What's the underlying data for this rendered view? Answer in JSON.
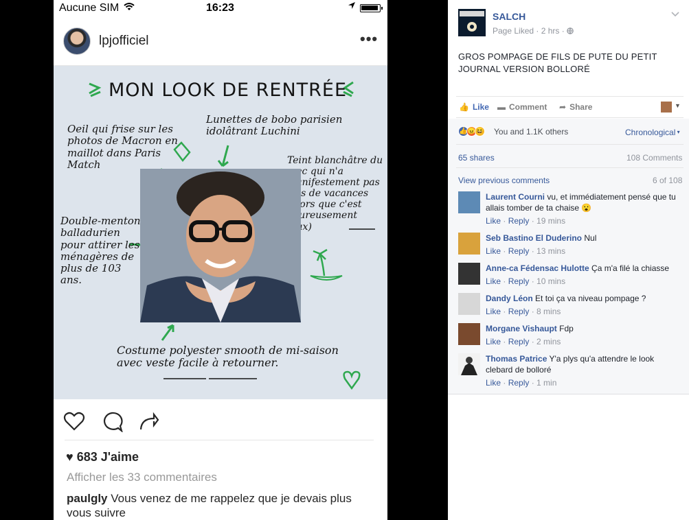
{
  "instagram": {
    "status": {
      "carrier": "Aucune SIM",
      "time": "16:23"
    },
    "username": "lpjofficiel",
    "image_text": {
      "title": "MON LOOK DE RENTRÉE",
      "note1": "Oeil qui frise sur les photos de Macron en maillot dans Paris Match",
      "note2": "Lunettes de bobo parisien idolâtrant Luchini",
      "note3": "Teint blanchâtre du mec qui n'a manifestement pas pris de vacances (alors que c'est heureusement faux)",
      "note4": "Double-menton balladurien pour attirer les ménagères de plus de 103 ans.",
      "note5": "Costume polyester smooth de mi-saison avec veste facile à retourner."
    },
    "likes": "683 J'aime",
    "view_all": "Afficher les 33 commentaires",
    "comment": {
      "author": "paulgly",
      "text": "Vous venez de me rappelez que je devais plus vous suivre"
    }
  },
  "facebook": {
    "page_name": "SALCH",
    "meta": "Page Liked · 2 hrs · ",
    "post_text": "GROS POMPAGE DE FILS DE PUTE DU PETIT JOURNAL VERSION BOLLORÉ",
    "actions": {
      "like": "Like",
      "comment": "Comment",
      "share": "Share"
    },
    "reactions_text": "You and 1.1K others",
    "sort": "Chronological",
    "shares": "65 shares",
    "comments_count": "108 Comments",
    "view_previous": "View previous comments",
    "page_of": "6 of 108",
    "comments": [
      {
        "author": "Laurent Courni",
        "text": "vu, et immédiatement pensé que tu allais tomber de ta chaise 😮",
        "like": "Like",
        "reply": "Reply",
        "time": "19 mins",
        "color": "#5d8ab5"
      },
      {
        "author": "Seb Bastino El Duderino",
        "text": "Nul",
        "like": "Like",
        "reply": "Reply",
        "time": "13 mins",
        "color": "#d9a23c"
      },
      {
        "author": "Anne-ca Fédensac Hulotte",
        "text": "Ça m'a filé la chiasse",
        "like": "Like",
        "reply": "Reply",
        "time": "10 mins",
        "color": "#333333"
      },
      {
        "author": "Dandy Léon",
        "text": "Et toi ça va niveau pompage ?",
        "like": "Like",
        "reply": "Reply",
        "time": "8 mins",
        "color": "#d7d7d7"
      },
      {
        "author": "Morgane Vishaupt",
        "text": "Fdp",
        "like": "Like",
        "reply": "Reply",
        "time": "2 mins",
        "color": "#7a4a2e"
      },
      {
        "author": "Thomas Patrice",
        "text": "Y'a plys qu'a attendre le look clebard de bolloré",
        "like": "Like",
        "reply": "Reply",
        "time": "1 min",
        "color": "#3a3a3a"
      }
    ]
  },
  "colors": {
    "fb_blue": "#365899",
    "fb_gray": "#90949c",
    "ig_text": "#262626",
    "accent_green": "#2fa84f"
  }
}
